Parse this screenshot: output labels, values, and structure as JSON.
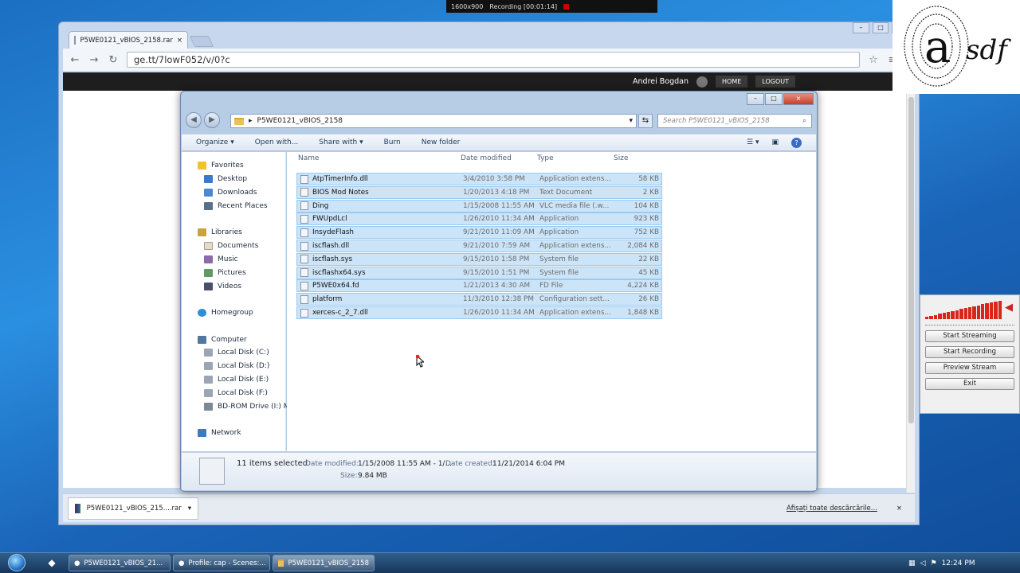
{
  "recorder_bar": {
    "resolution": "1600x900",
    "status": "Recording [00:01:14]"
  },
  "browser": {
    "tab_title": "P5WE0121_vBIOS_2158.rar",
    "url": "ge.tt/7lowF052/v/0?c",
    "site": {
      "user": "Andrei Bogdan",
      "home": "HOME",
      "logout": "LOGOUT"
    },
    "download": {
      "file": "P5WE0121_vBIOS_215....rar",
      "show_all": "Afișați toate descărcările..."
    }
  },
  "explorer": {
    "address": "P5WE0121_vBIOS_2158",
    "search_placeholder": "Search P5WE0121_vBIOS_2158",
    "commands": {
      "organize": "Organize",
      "open_with": "Open with...",
      "share_with": "Share with",
      "burn": "Burn",
      "new_folder": "New folder"
    },
    "nav": {
      "favorites": "Favorites",
      "desktop": "Desktop",
      "downloads": "Downloads",
      "recent": "Recent Places",
      "libraries": "Libraries",
      "documents": "Documents",
      "music": "Music",
      "pictures": "Pictures",
      "videos": "Videos",
      "homegroup": "Homegroup",
      "computer": "Computer",
      "disk_c": "Local Disk (C:)",
      "disk_d": "Local Disk (D:)",
      "disk_e": "Local Disk (E:)",
      "disk_f": "Local Disk (F:)",
      "bd": "BD-ROM Drive (I:) M",
      "network": "Network"
    },
    "columns": {
      "name": "Name",
      "date": "Date modified",
      "type": "Type",
      "size": "Size"
    },
    "files": [
      {
        "name": "AtpTimerInfo.dll",
        "date": "3/4/2010 3:58 PM",
        "type": "Application extens...",
        "size": "58 KB"
      },
      {
        "name": "BIOS Mod Notes",
        "date": "1/20/2013 4:18 PM",
        "type": "Text Document",
        "size": "2 KB"
      },
      {
        "name": "Ding",
        "date": "1/15/2008 11:55 AM",
        "type": "VLC media file (.w...",
        "size": "104 KB"
      },
      {
        "name": "FWUpdLcl",
        "date": "1/26/2010 11:34 AM",
        "type": "Application",
        "size": "923 KB"
      },
      {
        "name": "InsydeFlash",
        "date": "9/21/2010 11:09 AM",
        "type": "Application",
        "size": "752 KB"
      },
      {
        "name": "iscflash.dll",
        "date": "9/21/2010 7:59 AM",
        "type": "Application extens...",
        "size": "2,084 KB"
      },
      {
        "name": "iscflash.sys",
        "date": "9/15/2010 1:58 PM",
        "type": "System file",
        "size": "22 KB"
      },
      {
        "name": "iscflashx64.sys",
        "date": "9/15/2010 1:51 PM",
        "type": "System file",
        "size": "45 KB"
      },
      {
        "name": "P5WE0x64.fd",
        "date": "1/21/2013 4:30 AM",
        "type": "FD File",
        "size": "4,224 KB"
      },
      {
        "name": "platform",
        "date": "11/3/2010 12:38 PM",
        "type": "Configuration sett...",
        "size": "26 KB"
      },
      {
        "name": "xerces-c_2_7.dll",
        "date": "1/26/2010 11:34 AM",
        "type": "Application extens...",
        "size": "1,848 KB"
      }
    ],
    "details": {
      "selected": "11 items selected",
      "modified_label": "Date modified:",
      "modified": "1/15/2008 11:55 AM - 1/...",
      "created_label": "Date created:",
      "created": "11/21/2014 6:04 PM",
      "size_label": "Size:",
      "size": "9.84 MB"
    }
  },
  "recorder_panel": {
    "start_streaming": "Start Streaming",
    "start_recording": "Start Recording",
    "preview_stream": "Preview Stream",
    "exit": "Exit"
  },
  "taskbar": {
    "tasks": [
      "P5WE0121_vBIOS_21...",
      "Profile: cap - Scenes:...",
      "P5WE0121_vBIOS_2158"
    ],
    "clock": "12:24 PM"
  }
}
